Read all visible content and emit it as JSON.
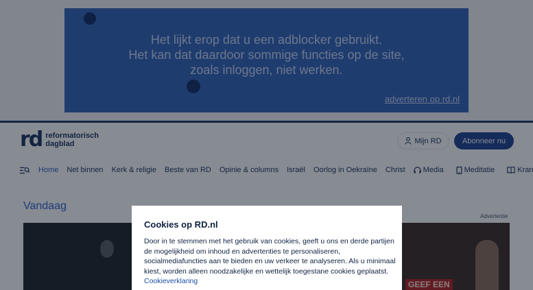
{
  "ad_banner": {
    "message_lines": [
      "Het lijkt erop dat u een adblocker gebruikt.",
      "Het kan dat daardoor sommige functies op de site,",
      "zoals inloggen, niet werken."
    ],
    "link": "adverteren op rd.nl"
  },
  "header": {
    "logo_mark": "rd",
    "logo_line1": "reformatorisch",
    "logo_line2": "dagblad",
    "account_button": "Mijn RD",
    "subscribe_button": "Abonneer nu"
  },
  "nav": {
    "items": [
      {
        "label": "Home"
      },
      {
        "label": "Net binnen"
      },
      {
        "label": "Kerk & religie"
      },
      {
        "label": "Beste van RD"
      },
      {
        "label": "Opinie & columns"
      },
      {
        "label": "Israël"
      },
      {
        "label": "Oorlog in Oekraïne"
      },
      {
        "label": "Christ"
      },
      {
        "label": "Media"
      },
      {
        "label": "Meditatie"
      },
      {
        "label": "Krant"
      }
    ]
  },
  "content": {
    "section_title": "Vandaag",
    "ad_label": "Advertentie",
    "ad_image_text": "GEEF EEN"
  },
  "cookie_modal": {
    "title": "Cookies op RD.nl",
    "body_lines": [
      "Door in te stemmen met het gebruik van cookies, geeft u ons en derde partijen",
      "de mogelijkheid om inhoud en advertenties te personaliseren,",
      "socialmediafuncties aan te bieden en uw verkeer te analyseren. Als u minimaal",
      "kiest, worden alleen noodzakelijke en wettelijk toegestane cookies geplaatst."
    ],
    "link": "Cookieverklaring"
  },
  "colors": {
    "brand_navy": "#14305a",
    "accent_blue": "#2a5cc8",
    "subscribe_bg": "#1b3f8f",
    "ad_banner_bg": "#2f60b8"
  }
}
